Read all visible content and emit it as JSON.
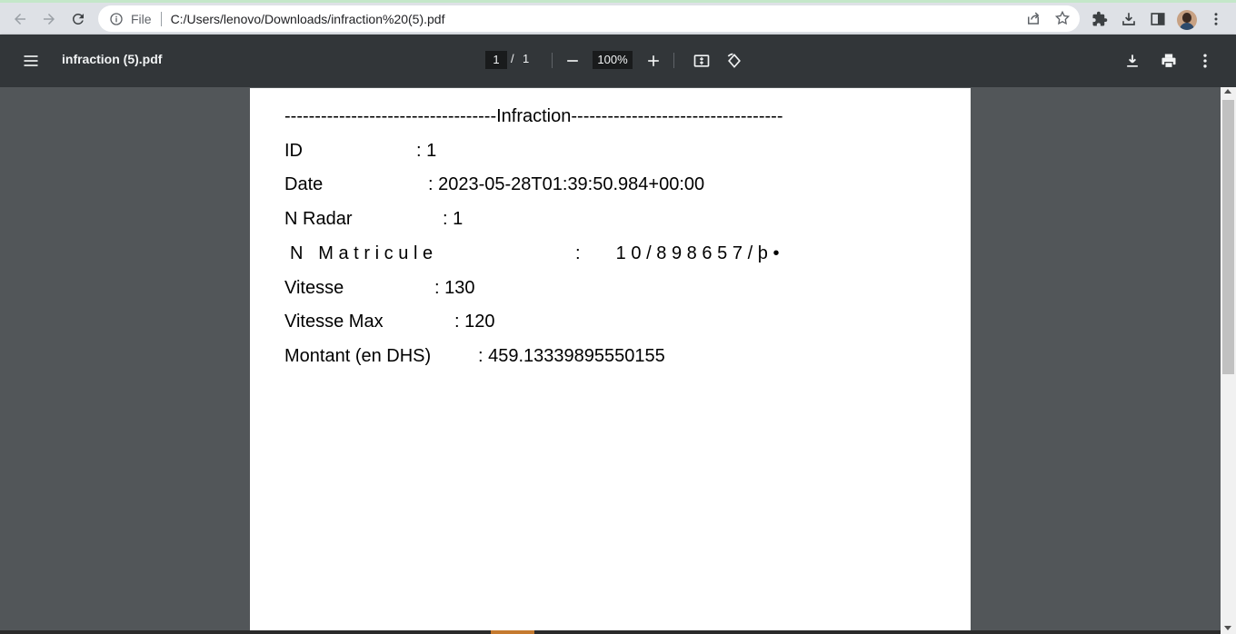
{
  "browser": {
    "scheme_label": "File",
    "url": "C:/Users/lenovo/Downloads/infraction%20(5).pdf",
    "accent_color": "#c4e7c9"
  },
  "toolbar": {
    "title": "infraction (5).pdf",
    "page_current": "1",
    "page_separator": "/",
    "page_total": "1",
    "zoom": "100%"
  },
  "document": {
    "title_line": "-----------------------------------Infraction-----------------------------------",
    "rows": [
      {
        "label": "ID",
        "value": ": 1"
      },
      {
        "label": "Date",
        "value": ": 2023-05-28T01:39:50.984+00:00"
      },
      {
        "label": "N Radar",
        "value": ": 1"
      },
      {
        "label": "N Matricule",
        "value": ":   10/898657/þ•"
      },
      {
        "label": "Vitesse",
        "value": ": 130"
      },
      {
        "label": "Vitesse Max",
        "value": ": 120"
      },
      {
        "label": "Montant (en DHS)",
        "value": ": 459.13339895550155"
      }
    ]
  },
  "icons": {
    "back": "arrow-left-icon",
    "forward": "arrow-right-icon",
    "reload": "reload-icon",
    "info": "info-icon",
    "share": "share-icon",
    "bookmark": "star-icon",
    "extensions": "puzzle-icon",
    "downloads": "download-icon",
    "sidepanel": "side-panel-icon",
    "menu": "kebab-menu-icon",
    "sidebar_toggle": "hamburger-icon",
    "zoom_out": "minus-icon",
    "zoom_in": "plus-icon",
    "fit": "fit-page-icon",
    "rotate": "rotate-icon",
    "pdf_download": "download-icon",
    "print": "print-icon",
    "pdf_more": "kebab-menu-icon"
  }
}
